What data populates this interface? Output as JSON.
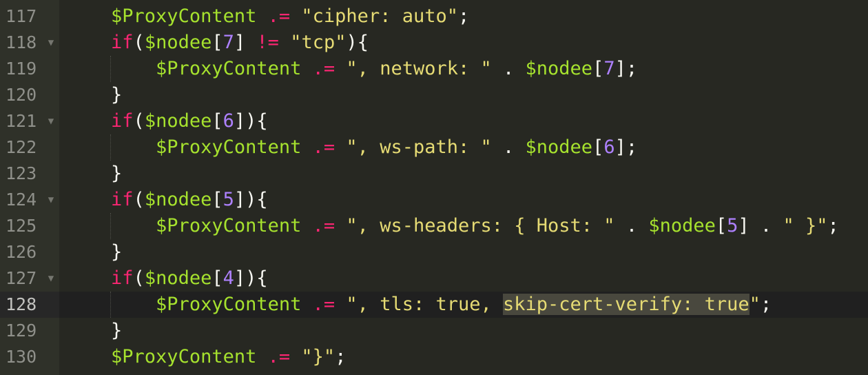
{
  "editor": {
    "theme": "monokai",
    "colors": {
      "background": "#272822",
      "gutter": "#2f3129",
      "variable": "#a6e22e",
      "operator": "#f92672",
      "string": "#e6db74",
      "number": "#ae81ff",
      "plain": "#f8f8f2",
      "line_number": "#8f908a",
      "selection_highlight": "#49483e"
    },
    "active_line": "128",
    "fold_icon": "triangle-down-icon",
    "fold_glyph": "▼",
    "lines": [
      {
        "n": "117",
        "fold": false,
        "tokens": [
          {
            "t": "    ",
            "c": "pn"
          },
          {
            "t": "$ProxyContent",
            "c": "var"
          },
          {
            "t": " ",
            "c": "pn"
          },
          {
            "t": ".=",
            "c": "op"
          },
          {
            "t": " ",
            "c": "pn"
          },
          {
            "t": "\"cipher: auto\"",
            "c": "str"
          },
          {
            "t": ";",
            "c": "pn"
          }
        ]
      },
      {
        "n": "118",
        "fold": true,
        "tokens": [
          {
            "t": "    ",
            "c": "pn"
          },
          {
            "t": "if",
            "c": "kw"
          },
          {
            "t": "(",
            "c": "pn"
          },
          {
            "t": "$nodee",
            "c": "var"
          },
          {
            "t": "[",
            "c": "pn"
          },
          {
            "t": "7",
            "c": "num"
          },
          {
            "t": "] ",
            "c": "pn"
          },
          {
            "t": "!=",
            "c": "op"
          },
          {
            "t": " ",
            "c": "pn"
          },
          {
            "t": "\"tcp\"",
            "c": "str"
          },
          {
            "t": "){",
            "c": "pn"
          }
        ]
      },
      {
        "n": "119",
        "fold": false,
        "guide": true,
        "tokens": [
          {
            "t": "        ",
            "c": "pn"
          },
          {
            "t": "$ProxyContent",
            "c": "var"
          },
          {
            "t": " ",
            "c": "pn"
          },
          {
            "t": ".=",
            "c": "op"
          },
          {
            "t": " ",
            "c": "pn"
          },
          {
            "t": "\", network: \"",
            "c": "str"
          },
          {
            "t": " . ",
            "c": "pn"
          },
          {
            "t": "$nodee",
            "c": "var"
          },
          {
            "t": "[",
            "c": "pn"
          },
          {
            "t": "7",
            "c": "num"
          },
          {
            "t": "];",
            "c": "pn"
          }
        ]
      },
      {
        "n": "120",
        "fold": false,
        "tokens": [
          {
            "t": "    }",
            "c": "pn"
          }
        ]
      },
      {
        "n": "121",
        "fold": true,
        "tokens": [
          {
            "t": "    ",
            "c": "pn"
          },
          {
            "t": "if",
            "c": "kw"
          },
          {
            "t": "(",
            "c": "pn"
          },
          {
            "t": "$nodee",
            "c": "var"
          },
          {
            "t": "[",
            "c": "pn"
          },
          {
            "t": "6",
            "c": "num"
          },
          {
            "t": "]){",
            "c": "pn"
          }
        ]
      },
      {
        "n": "122",
        "fold": false,
        "guide": true,
        "tokens": [
          {
            "t": "        ",
            "c": "pn"
          },
          {
            "t": "$ProxyContent",
            "c": "var"
          },
          {
            "t": " ",
            "c": "pn"
          },
          {
            "t": ".=",
            "c": "op"
          },
          {
            "t": " ",
            "c": "pn"
          },
          {
            "t": "\", ws-path: \"",
            "c": "str"
          },
          {
            "t": " . ",
            "c": "pn"
          },
          {
            "t": "$nodee",
            "c": "var"
          },
          {
            "t": "[",
            "c": "pn"
          },
          {
            "t": "6",
            "c": "num"
          },
          {
            "t": "];",
            "c": "pn"
          }
        ]
      },
      {
        "n": "123",
        "fold": false,
        "tokens": [
          {
            "t": "    }",
            "c": "pn"
          }
        ]
      },
      {
        "n": "124",
        "fold": true,
        "tokens": [
          {
            "t": "    ",
            "c": "pn"
          },
          {
            "t": "if",
            "c": "kw"
          },
          {
            "t": "(",
            "c": "pn"
          },
          {
            "t": "$nodee",
            "c": "var"
          },
          {
            "t": "[",
            "c": "pn"
          },
          {
            "t": "5",
            "c": "num"
          },
          {
            "t": "]){",
            "c": "pn"
          }
        ]
      },
      {
        "n": "125",
        "fold": false,
        "guide": true,
        "tokens": [
          {
            "t": "        ",
            "c": "pn"
          },
          {
            "t": "$ProxyContent",
            "c": "var"
          },
          {
            "t": " ",
            "c": "pn"
          },
          {
            "t": ".=",
            "c": "op"
          },
          {
            "t": " ",
            "c": "pn"
          },
          {
            "t": "\", ws-headers: { Host: \"",
            "c": "str"
          },
          {
            "t": " . ",
            "c": "pn"
          },
          {
            "t": "$nodee",
            "c": "var"
          },
          {
            "t": "[",
            "c": "pn"
          },
          {
            "t": "5",
            "c": "num"
          },
          {
            "t": "] . ",
            "c": "pn"
          },
          {
            "t": "\" }\"",
            "c": "str"
          },
          {
            "t": ";",
            "c": "pn"
          }
        ]
      },
      {
        "n": "126",
        "fold": false,
        "tokens": [
          {
            "t": "    }",
            "c": "pn"
          }
        ]
      },
      {
        "n": "127",
        "fold": true,
        "tokens": [
          {
            "t": "    ",
            "c": "pn"
          },
          {
            "t": "if",
            "c": "kw"
          },
          {
            "t": "(",
            "c": "pn"
          },
          {
            "t": "$nodee",
            "c": "var"
          },
          {
            "t": "[",
            "c": "pn"
          },
          {
            "t": "4",
            "c": "num"
          },
          {
            "t": "]){",
            "c": "pn"
          }
        ]
      },
      {
        "n": "128",
        "fold": false,
        "guide": true,
        "tokens": [
          {
            "t": "        ",
            "c": "pn"
          },
          {
            "t": "$ProxyContent",
            "c": "var"
          },
          {
            "t": " ",
            "c": "pn"
          },
          {
            "t": ".=",
            "c": "op"
          },
          {
            "t": " ",
            "c": "pn"
          },
          {
            "t": "\", tls: true, ",
            "c": "str"
          },
          {
            "t": "skip-cert-verify: true",
            "c": "hl"
          },
          {
            "t": "\"",
            "c": "str"
          },
          {
            "t": ";",
            "c": "pn"
          }
        ]
      },
      {
        "n": "129",
        "fold": false,
        "tokens": [
          {
            "t": "    }",
            "c": "pn"
          }
        ]
      },
      {
        "n": "130",
        "fold": false,
        "tokens": [
          {
            "t": "    ",
            "c": "pn"
          },
          {
            "t": "$ProxyContent",
            "c": "var"
          },
          {
            "t": " ",
            "c": "pn"
          },
          {
            "t": ".=",
            "c": "op"
          },
          {
            "t": " ",
            "c": "pn"
          },
          {
            "t": "\"}\"",
            "c": "str"
          },
          {
            "t": ";",
            "c": "pn"
          }
        ]
      }
    ]
  }
}
